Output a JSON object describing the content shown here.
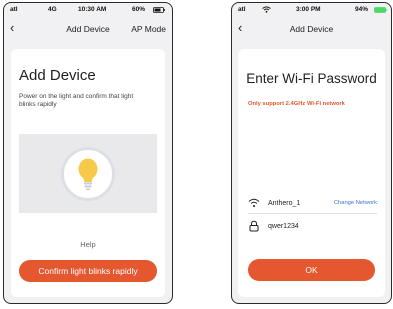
{
  "left": {
    "status": {
      "carrier": "atl",
      "network": "4G",
      "time": "10:30 AM",
      "battery": "60%"
    },
    "nav": {
      "title": "Add Device",
      "right": "AP Mode"
    },
    "heading": "Add Device",
    "description": "Power on the light and confirm that light blinks  rapidly",
    "help": "Help",
    "confirm_label": "Confirm light blinks rapidly"
  },
  "right": {
    "status": {
      "carrier": "atl",
      "time": "3:00 PM",
      "battery": "94%"
    },
    "nav": {
      "title": "Add Device"
    },
    "heading": "Enter Wi-Fi Password",
    "warning": "Only support 2.4GHz Wi-Fi network",
    "ssid": "Anthero_1",
    "change_network": "Change Network",
    "password": "qwer1234",
    "ok_label": "OK"
  },
  "colors": {
    "accent": "#e5582f",
    "link": "#3d73d8",
    "bulb": "#f7c948"
  }
}
